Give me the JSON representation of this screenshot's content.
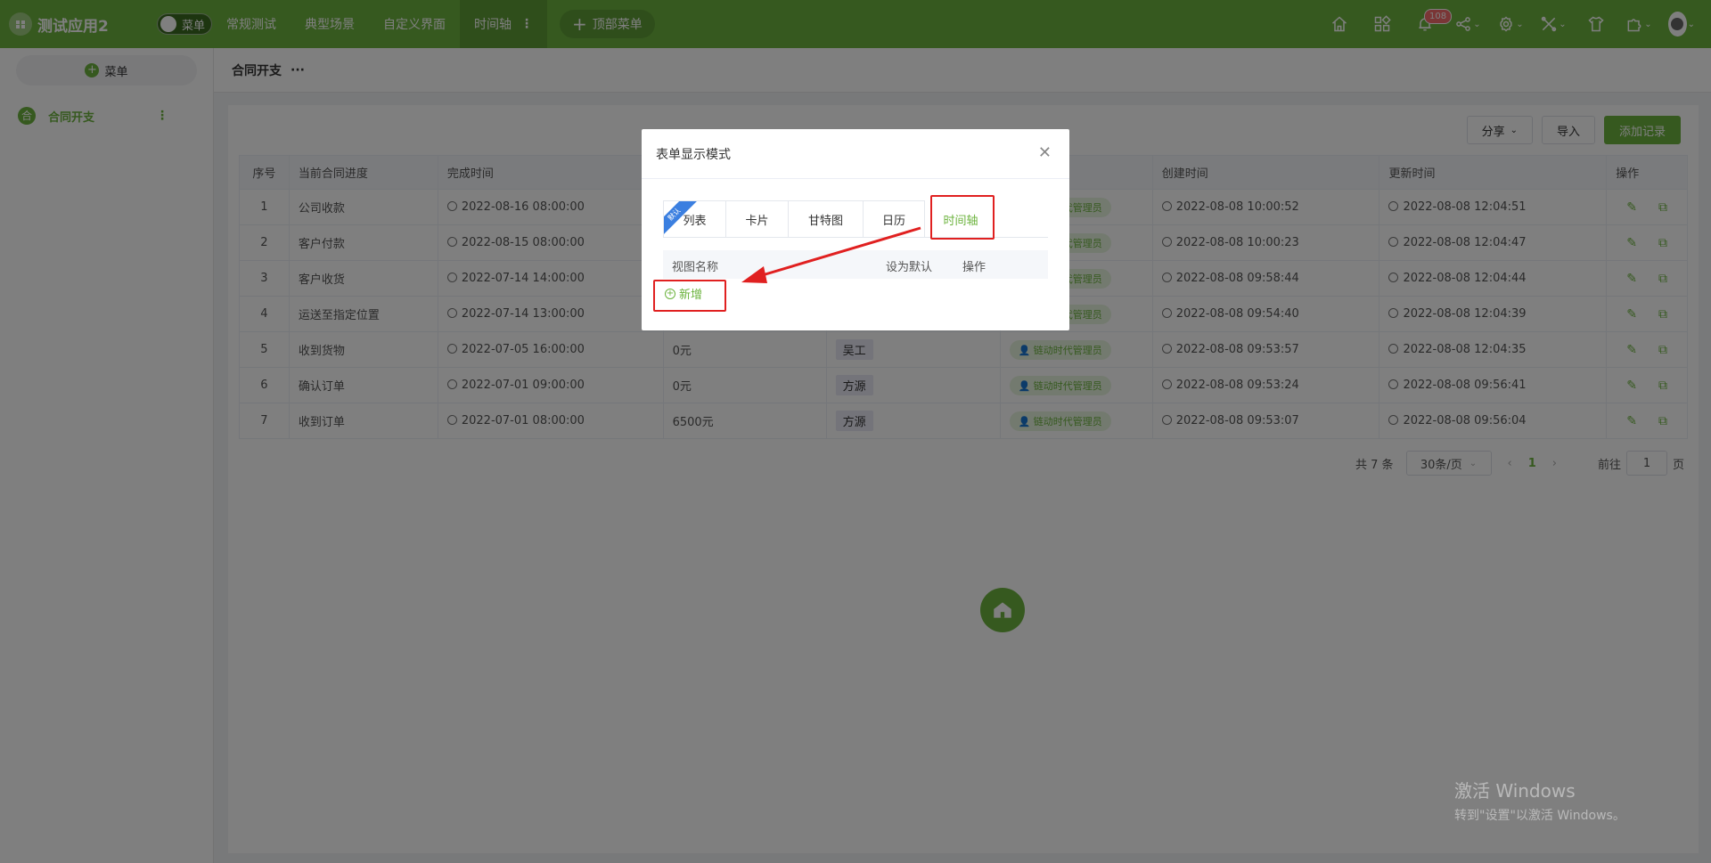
{
  "app": {
    "title": "测试应用2",
    "menu_toggle_label": "菜单"
  },
  "topnav": {
    "items": [
      {
        "label": "常规测试"
      },
      {
        "label": "典型场景"
      },
      {
        "label": "自定义界面"
      },
      {
        "label": "时间轴"
      }
    ],
    "top_menu_label": "顶部菜单",
    "notification_count": "108"
  },
  "sidebar": {
    "menu_button_label": "菜单",
    "items": [
      {
        "icon_char": "合",
        "label": "合同开支"
      }
    ]
  },
  "page": {
    "title": "合同开支"
  },
  "toolbar": {
    "share_label": "分享",
    "import_label": "导入",
    "add_label": "添加记录"
  },
  "table": {
    "headers": [
      "序号",
      "当前合同进度",
      "完成时间",
      "",
      "",
      "",
      "创建时间",
      "更新时间",
      "操作"
    ],
    "rows": [
      {
        "no": "1",
        "progress": "公司收款",
        "done": "2022-08-16 08:00:00",
        "amount": "",
        "person": "",
        "role": "链动时代管理员",
        "created": "2022-08-08 10:00:52",
        "updated": "2022-08-08 12:04:51"
      },
      {
        "no": "2",
        "progress": "客户付款",
        "done": "2022-08-15 08:00:00",
        "amount": "",
        "person": "",
        "role": "链动时代管理员",
        "created": "2022-08-08 10:00:23",
        "updated": "2022-08-08 12:04:47"
      },
      {
        "no": "3",
        "progress": "客户收货",
        "done": "2022-07-14 14:00:00",
        "amount": "",
        "person": "",
        "role": "链动时代管理员",
        "created": "2022-08-08 09:58:44",
        "updated": "2022-08-08 12:04:44"
      },
      {
        "no": "4",
        "progress": "运送至指定位置",
        "done": "2022-07-14 13:00:00",
        "amount": "",
        "person": "",
        "role": "链动时代管理员",
        "created": "2022-08-08 09:54:40",
        "updated": "2022-08-08 12:04:39"
      },
      {
        "no": "5",
        "progress": "收到货物",
        "done": "2022-07-05 16:00:00",
        "amount": "0元",
        "person": "吴工",
        "role": "链动时代管理员",
        "created": "2022-08-08 09:53:57",
        "updated": "2022-08-08 12:04:35"
      },
      {
        "no": "6",
        "progress": "确认订单",
        "done": "2022-07-01 09:00:00",
        "amount": "0元",
        "person": "方源",
        "role": "链动时代管理员",
        "created": "2022-08-08 09:53:24",
        "updated": "2022-08-08 09:56:41"
      },
      {
        "no": "7",
        "progress": "收到订单",
        "done": "2022-07-01 08:00:00",
        "amount": "6500元",
        "person": "方源",
        "role": "链动时代管理员",
        "created": "2022-08-08 09:53:07",
        "updated": "2022-08-08 09:56:04"
      }
    ]
  },
  "pager": {
    "total": "共 7 条",
    "page_size": "30条/页",
    "current": "1",
    "goto_label": "前往",
    "goto_value": "1",
    "page_suffix": "页"
  },
  "modal": {
    "title": "表单显示模式",
    "tabs": [
      {
        "label": "列表",
        "ribbon": "默认"
      },
      {
        "label": "卡片"
      },
      {
        "label": "甘特图"
      },
      {
        "label": "日历"
      },
      {
        "label": "时间轴"
      }
    ],
    "columns": [
      "视图名称",
      "设为默认",
      "操作"
    ],
    "add_label": "新增"
  },
  "watermark": {
    "line1": "激活 Windows",
    "line2": "转到\"设置\"以激活 Windows。"
  },
  "colors": {
    "brand": "#6cb33e",
    "highlight": "#e02020",
    "ribbon": "#3b7fe0"
  }
}
